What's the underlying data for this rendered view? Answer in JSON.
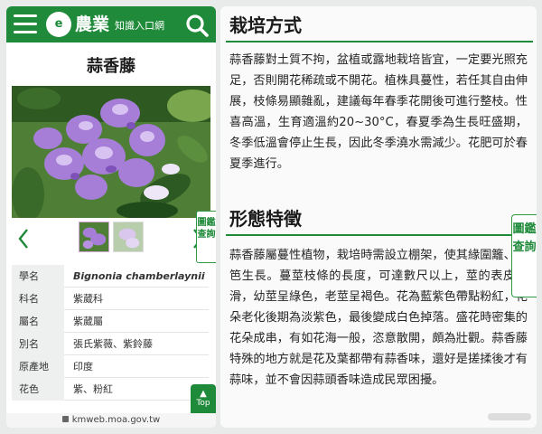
{
  "header": {
    "logo_mark": "e",
    "logo_main": "農業",
    "logo_sub": "知識入口網"
  },
  "plant": {
    "name": "蒜香藤"
  },
  "side_tab": {
    "label": "圖鑑查詢"
  },
  "info": [
    {
      "key": "學名",
      "value": "Bignonia chamberlaynii"
    },
    {
      "key": "科名",
      "value": "紫葳科"
    },
    {
      "key": "屬名",
      "value": "紫葳屬"
    },
    {
      "key": "別名",
      "value": "張氏紫薇、紫鈴藤"
    },
    {
      "key": "原產地",
      "value": "印度"
    },
    {
      "key": "花色",
      "value": "紫、粉紅"
    }
  ],
  "top_button": {
    "label": "Top"
  },
  "url": "kmweb.moa.gov.tw",
  "article": {
    "section1_title": "栽培方式",
    "section1_text": "蒜香藤對土質不拘，盆植或露地栽培皆宜，一定要光照充足，否則開花稀疏或不開花。植株具蔓性，若任其自由伸展，枝條易顯雜亂，建議每年春季花開後可進行整枝。性喜高溫，生育適溫約20~30°C，春夏季為生長旺盛期，冬季低溫會停止生長，因此冬季澆水需減少。花肥可於春夏季進行。",
    "section2_title": "形態特徵",
    "section2_text": "蒜香藤屬蔓性植物，栽培時需設立棚架，使其緣圍籬、籬笆生長。蔓莖枝條的長度，可達數尺以上，莖的表皮光滑，幼莖呈綠色，老莖呈褐色。花為藍紫色帶點粉紅，花朵老化後期為淡紫色，最後變成白色掉落。盛花時密集的花朵成串，有如花海一般，恣意散開，頗為壯觀。蒜香藤特殊的地方就是花及葉都帶有蒜香味，還好是搓揉後才有蒜味，並不會因蒜頭香味造成民眾困擾。"
  },
  "colors": {
    "brand_green": "#1f8a3a",
    "flower_purple": "#a87fd6"
  }
}
